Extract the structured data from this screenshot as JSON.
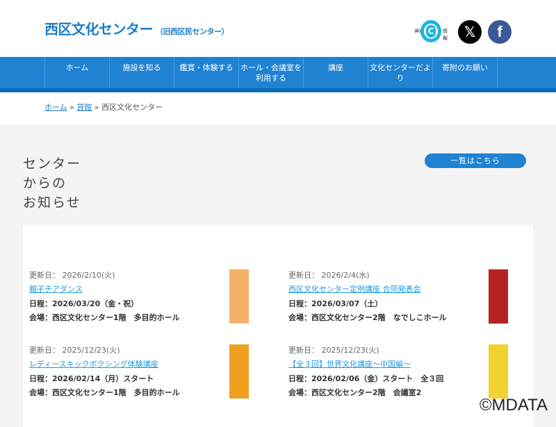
{
  "header": {
    "title": "西区文化センター",
    "subtitle": "（旧西区民センター）",
    "kobe_logo": {
      "left": "神戸",
      "mark": "C",
      "right": "情報"
    },
    "x_icon": "𝕏",
    "fb_icon": "f"
  },
  "nav": {
    "items": [
      "ホーム",
      "施設を知る",
      "鑑賞・体験する",
      "ホール・会議室を利用する",
      "講座",
      "文化センターだより",
      "寄附のお願い"
    ]
  },
  "breadcrumb": {
    "home": "ホーム",
    "sep": "»",
    "parent": "貸館",
    "current": "西区文化センター"
  },
  "section": {
    "title_lines": [
      "センター",
      "からの",
      "お知らせ"
    ],
    "all_button": "一覧はこちら"
  },
  "news": [
    {
      "date": "更新日： 2026/2/10(火)",
      "title": "親子チアダンス",
      "schedule": "日程：2026/03/20（金・祝）",
      "venue": "会場：西区文化センター1階　多目的ホール",
      "thumb_color": "#f3b26a"
    },
    {
      "date": "更新日： 2026/2/4(水)",
      "title": "西区文化センター定例講座 合同発表会",
      "schedule": "日程：2026/03/07（土）",
      "venue": "会場：西区文化センター2階　なでしこホール",
      "thumb_color": "#b3231f"
    },
    {
      "date": "更新日： 2025/12/23(火)",
      "title": "レディースキックボクシング体験講座",
      "schedule": "日程：2026/02/14（月）スタート",
      "venue": "会場：西区文化センター1階　多目的ホール",
      "thumb_color": "#f0a020"
    },
    {
      "date": "更新日： 2025/12/23(火)",
      "title": "【全３回】世界文化講座～中国編～",
      "schedule": "日程：2026/02/06（金）スタート　全３回",
      "venue": "会場：西区文化センター2階　会議室2",
      "thumb_color": "#f2d230"
    }
  ],
  "watermark": "©MDATA"
}
